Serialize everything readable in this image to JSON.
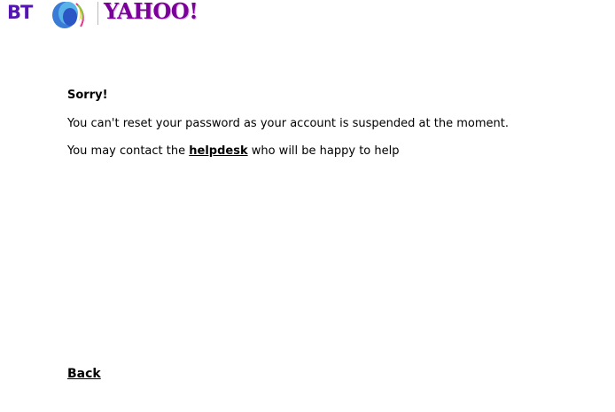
{
  "header": {
    "bt_logo_text": "BT",
    "yahoo_logo_text": "YAHOO!"
  },
  "main": {
    "title": "Sorry!",
    "message": "You can't reset your password as your account is suspended at the moment.",
    "contact_prefix": "You may contact the ",
    "helpdesk_link": "helpdesk",
    "contact_suffix": " who will be happy to help"
  },
  "footer": {
    "back_link": "Back"
  },
  "colors": {
    "bt_purple": "#5514b4",
    "yahoo_purple": "#7b0099",
    "text": "#000000"
  }
}
